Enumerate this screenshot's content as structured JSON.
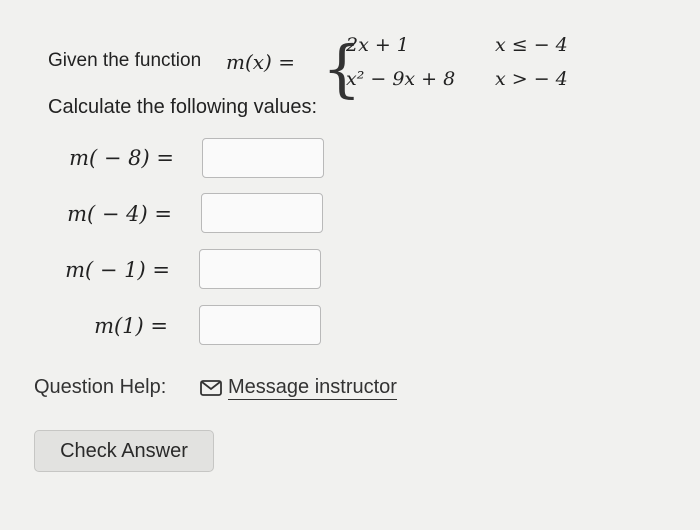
{
  "question": {
    "prompt": "Given the function",
    "function_name": "m(x) =",
    "cases": [
      {
        "expression": "2x + 1",
        "condition": "x ≤ − 4"
      },
      {
        "expression": "x² − 9x + 8",
        "condition": "x > − 4"
      }
    ],
    "instruction": "Calculate the following values:",
    "rows": [
      {
        "label": "m( − 8) =",
        "value": ""
      },
      {
        "label": "m( − 4) =",
        "value": ""
      },
      {
        "label": "m( − 1) =",
        "value": ""
      },
      {
        "label": "m(1) =",
        "value": ""
      }
    ]
  },
  "help": {
    "label": "Question Help:",
    "icon": "mail-icon",
    "link_text": "Message instructor"
  },
  "actions": {
    "check_answer": "Check Answer"
  }
}
